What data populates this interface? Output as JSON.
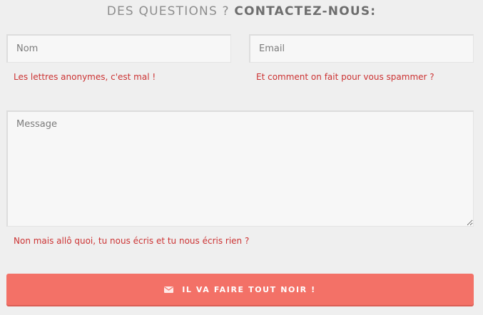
{
  "heading": {
    "light": "DES QUESTIONS ?",
    "bold": "CONTACTEZ-NOUS:"
  },
  "form": {
    "name": {
      "placeholder": "Nom",
      "hint": "Les lettres anonymes, c'est mal !"
    },
    "email": {
      "placeholder": "Email",
      "hint": "Et comment on fait pour vous spammer ?"
    },
    "message": {
      "placeholder": "Message",
      "hint": "Non mais allô quoi, tu nous écris et tu nous écris rien ?"
    },
    "submit": {
      "label": "IL VA FAIRE TOUT NOIR !",
      "icon": "envelope-icon"
    }
  },
  "colors": {
    "background": "#efefef",
    "accent": "#f37167",
    "hint_text": "#cc3333"
  }
}
